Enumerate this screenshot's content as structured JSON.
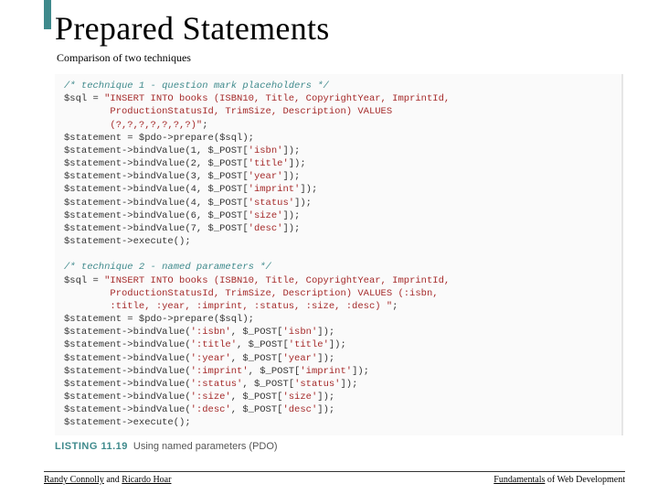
{
  "title": "Prepared Statements",
  "subtitle": "Comparison of two techniques",
  "code": {
    "t1_comment": "/* technique 1 - question mark placeholders */",
    "t1_l1a": "$sql = ",
    "t1_l1b": "\"INSERT INTO books (ISBN10, Title, CopyrightYear, ImprintId,",
    "t1_l2": "        ProductionStatusId, TrimSize, Description) VALUES",
    "t1_l3": "        (?,?,?,?,?,?,?)\"",
    "t1_l3b": ";",
    "t1_l4": "$statement = $pdo->prepare($sql);",
    "t1_l5a": "$statement->bindValue(1, $_POST[",
    "t1_l5b": "'isbn'",
    "t1_l5c": "]);",
    "t1_l6a": "$statement->bindValue(2, $_POST[",
    "t1_l6b": "'title'",
    "t1_l6c": "]);",
    "t1_l7a": "$statement->bindValue(3, $_POST[",
    "t1_l7b": "'year'",
    "t1_l7c": "]);",
    "t1_l8a": "$statement->bindValue(4, $_POST[",
    "t1_l8b": "'imprint'",
    "t1_l8c": "]);",
    "t1_l9a": "$statement->bindValue(4, $_POST[",
    "t1_l9b": "'status'",
    "t1_l9c": "]);",
    "t1_l10a": "$statement->bindValue(6, $_POST[",
    "t1_l10b": "'size'",
    "t1_l10c": "]);",
    "t1_l11a": "$statement->bindValue(7, $_POST[",
    "t1_l11b": "'desc'",
    "t1_l11c": "]);",
    "t1_l12": "$statement->execute();",
    "t2_comment": "/* technique 2 - named parameters */",
    "t2_l1a": "$sql = ",
    "t2_l1b": "\"INSERT INTO books (ISBN10, Title, CopyrightYear, ImprintId,",
    "t2_l2": "        ProductionStatusId, TrimSize, Description) VALUES (:isbn,",
    "t2_l3": "        :title, :year, :imprint, :status, :size, :desc) \"",
    "t2_l3b": ";",
    "t2_l4": "$statement = $pdo->prepare($sql);",
    "t2_l5a": "$statement->bindValue(",
    "t2_l5b": "':isbn'",
    "t2_l5c": ", $_POST[",
    "t2_l5d": "'isbn'",
    "t2_l5e": "]);",
    "t2_l6a": "$statement->bindValue(",
    "t2_l6b": "':title'",
    "t2_l6c": ", $_POST[",
    "t2_l6d": "'title'",
    "t2_l6e": "]);",
    "t2_l7a": "$statement->bindValue(",
    "t2_l7b": "':year'",
    "t2_l7c": ", $_POST[",
    "t2_l7d": "'year'",
    "t2_l7e": "]);",
    "t2_l8a": "$statement->bindValue(",
    "t2_l8b": "':imprint'",
    "t2_l8c": ", $_POST[",
    "t2_l8d": "'imprint'",
    "t2_l8e": "]);",
    "t2_l9a": "$statement->bindValue(",
    "t2_l9b": "':status'",
    "t2_l9c": ", $_POST[",
    "t2_l9d": "'status'",
    "t2_l9e": "]);",
    "t2_l10a": "$statement->bindValue(",
    "t2_l10b": "':size'",
    "t2_l10c": ", $_POST[",
    "t2_l10d": "'size'",
    "t2_l10e": "]);",
    "t2_l11a": "$statement->bindValue(",
    "t2_l11b": "':desc'",
    "t2_l11c": ", $_POST[",
    "t2_l11d": "'desc'",
    "t2_l11e": "]);",
    "t2_l12": "$statement->execute();"
  },
  "listing": {
    "num": "LISTING 11.19",
    "text": "Using named parameters (PDO)"
  },
  "footer": {
    "left_a": "Randy Connolly",
    "left_b": " and ",
    "left_c": "Ricardo Hoar",
    "right_a": "Fundamentals",
    "right_b": " of Web Development"
  }
}
